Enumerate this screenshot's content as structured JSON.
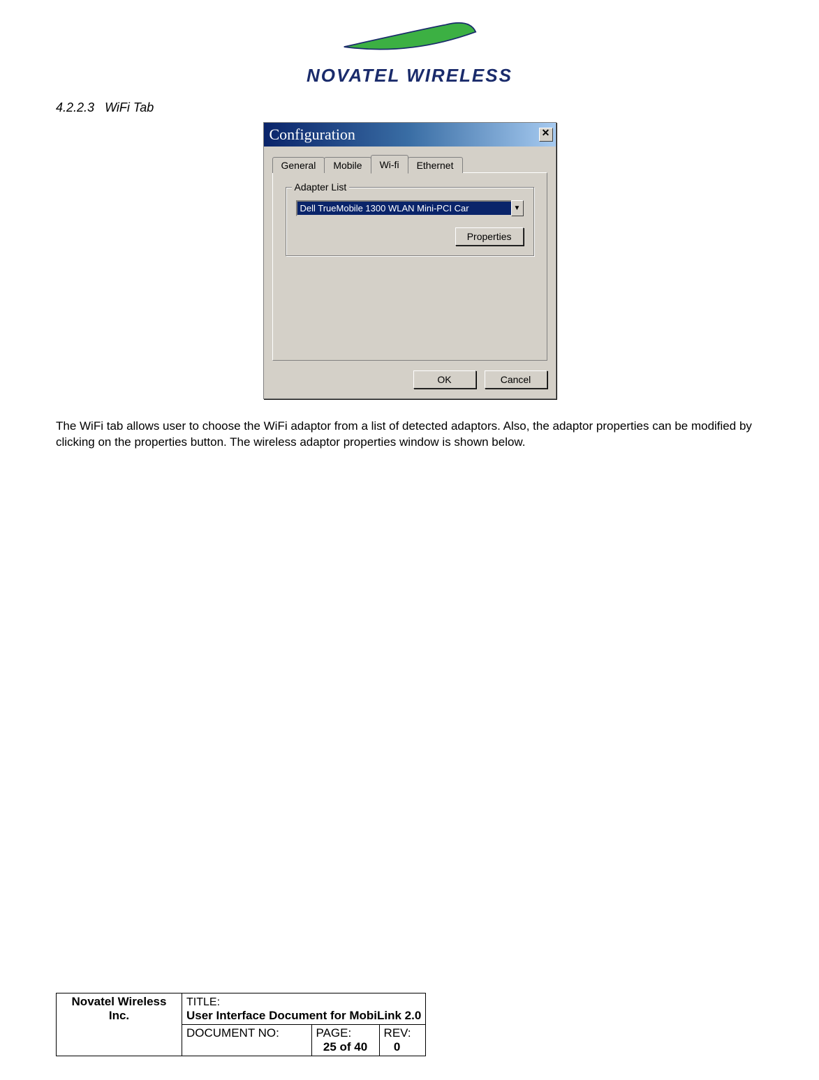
{
  "logo": {
    "company_name": "NOVATEL WIRELESS"
  },
  "section": {
    "number": "4.2.2.3",
    "title": "WiFi Tab"
  },
  "dialog": {
    "title": "Configuration",
    "close_tooltip": "Close",
    "tabs": {
      "general": "General",
      "mobile": "Mobile",
      "wifi": "Wi-fi",
      "ethernet": "Ethernet"
    },
    "adapter_list": {
      "label": "Adapter List",
      "selected": "Dell TrueMobile 1300 WLAN Mini-PCI Car",
      "properties_btn": "Properties"
    },
    "ok_btn": "OK",
    "cancel_btn": "Cancel"
  },
  "paragraph": "The WiFi tab allows user to choose the WiFi adaptor from a list of detected adaptors.  Also, the adaptor properties can be modified by clicking on the properties button.  The wireless adaptor properties window is shown below.",
  "footer": {
    "company": "Novatel Wireless Inc.",
    "title_label": "TITLE:",
    "title_value": "User Interface Document for MobiLink 2.0",
    "docno_label": "DOCUMENT NO:",
    "docno_value": "",
    "page_label": "PAGE:",
    "page_value": "25 of 40",
    "rev_label": "REV:",
    "rev_value": "0"
  }
}
